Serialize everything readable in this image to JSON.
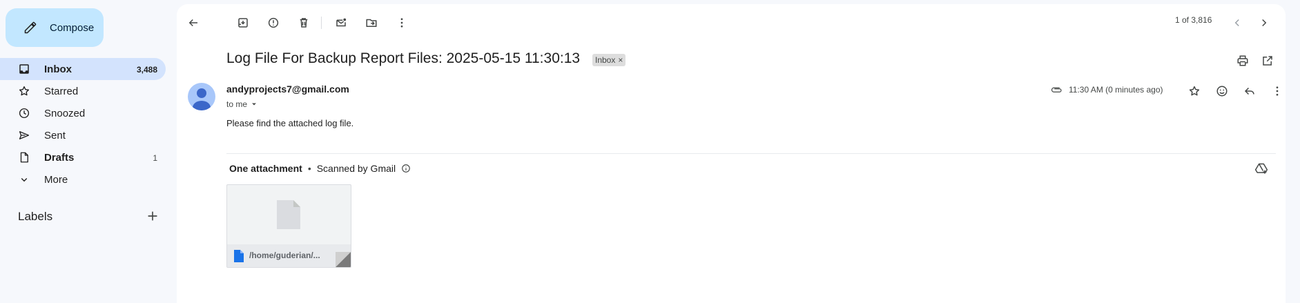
{
  "sidebar": {
    "compose_label": "Compose",
    "items": [
      {
        "label": "Inbox",
        "count": "3,488"
      },
      {
        "label": "Starred",
        "count": ""
      },
      {
        "label": "Snoozed",
        "count": ""
      },
      {
        "label": "Sent",
        "count": ""
      },
      {
        "label": "Drafts",
        "count": "1"
      },
      {
        "label": "More",
        "count": ""
      }
    ],
    "labels_heading": "Labels"
  },
  "toolbar": {
    "pager_text": "1 of 3,816"
  },
  "email": {
    "subject": "Log File For Backup Report Files: 2025-05-15 11:30:13",
    "tag": "Inbox",
    "tag_close": "×",
    "sender": "andyprojects7@gmail.com",
    "to": "to me",
    "time": "11:30 AM (0 minutes ago)",
    "body": "Please find the attached log file."
  },
  "attachments": {
    "heading": "One attachment",
    "separator": "•",
    "scanned": "Scanned by Gmail",
    "files": [
      {
        "name": "/home/guderian/..."
      }
    ]
  },
  "colors": {
    "compose_bg": "#c2e7ff",
    "active_nav": "#d3e3fd",
    "background": "#f6f8fc",
    "file_icon": "#1a73e8"
  }
}
